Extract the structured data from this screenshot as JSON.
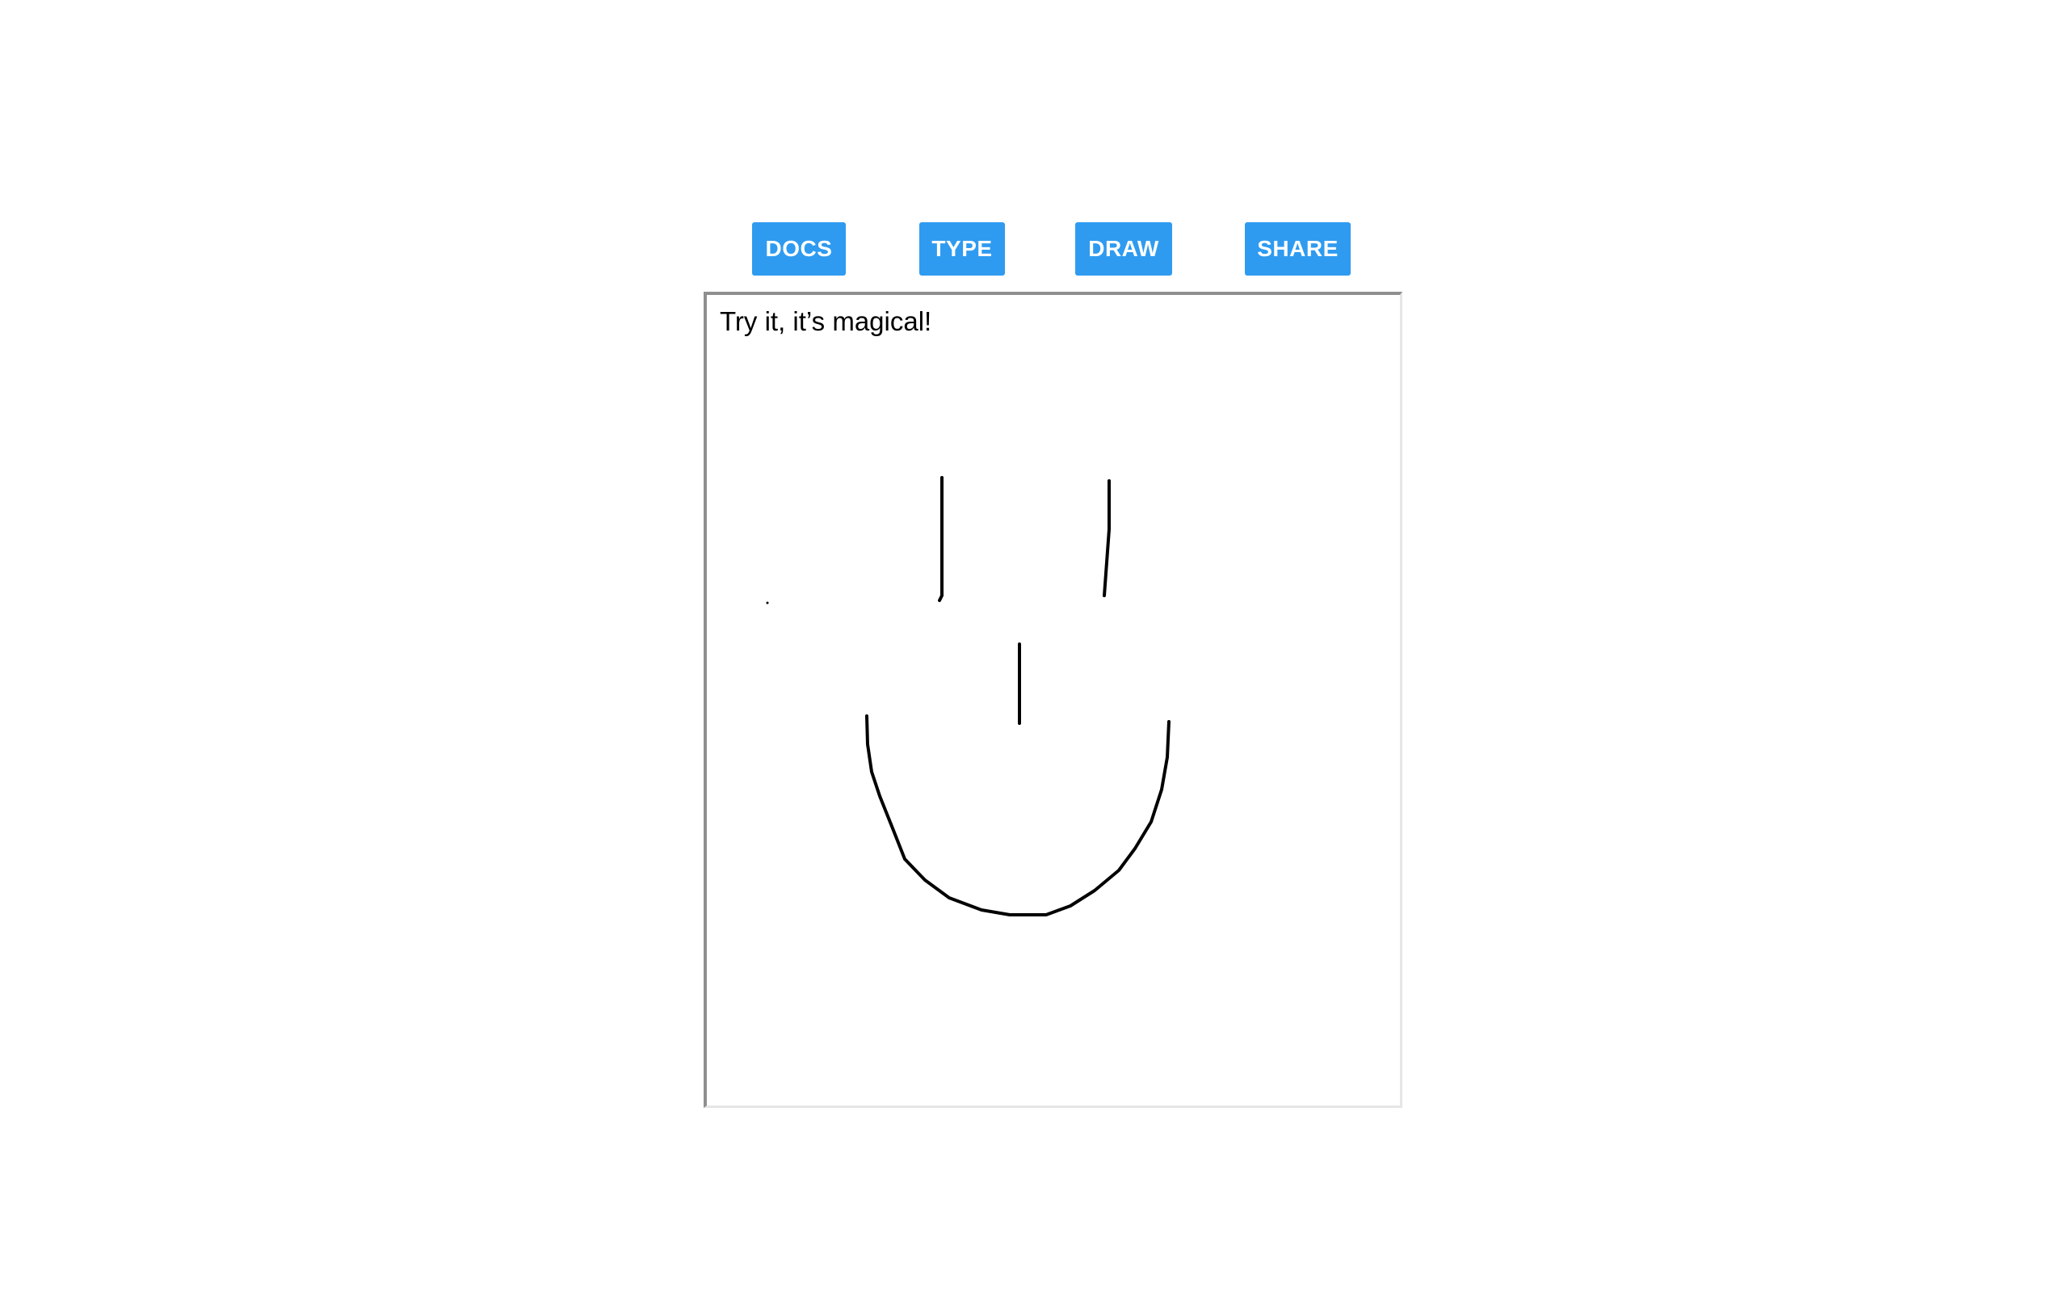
{
  "toolbar": {
    "buttons": [
      {
        "label": "DOCS"
      },
      {
        "label": "TYPE"
      },
      {
        "label": "DRAW"
      },
      {
        "label": "SHARE"
      }
    ]
  },
  "editor": {
    "text": "Try it, it’s magical!"
  },
  "colors": {
    "button_bg": "#2f9bf0",
    "button_text": "#ffffff",
    "ink": "#000000"
  }
}
